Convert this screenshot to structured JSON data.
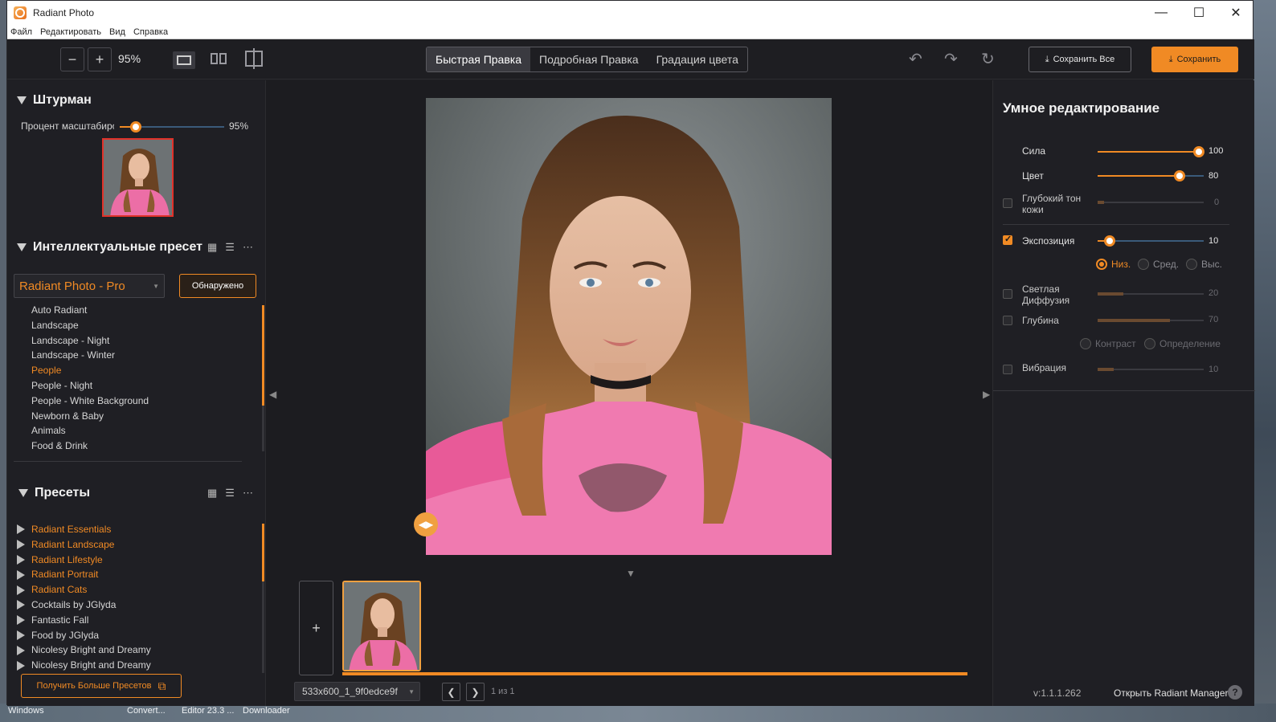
{
  "window": {
    "title": "Radiant Photo",
    "controls": [
      "—",
      "☐",
      "✕"
    ]
  },
  "menu": [
    "Файл",
    "Редактировать",
    "Вид",
    "Справка"
  ],
  "toolbar": {
    "zoom_out": "−",
    "zoom_in": "+",
    "zoom_level": "95%",
    "tabs": [
      "Быстрая Правка",
      "Подробная Правка",
      "Градация цвета"
    ],
    "active_tab": "Быстрая Правка",
    "save_all_label": "Сохранить Все",
    "save_label": "Сохранить"
  },
  "navigator": {
    "title": "Штурман",
    "zoom_label": "Процент масштабиро",
    "zoom_value": "95%",
    "zoom_fraction": 0.15
  },
  "smart_presets": {
    "title": "Интеллектуальные пресеты",
    "dropdown_value": "Radiant Photo - Pro",
    "detected_label": "Обнаружено",
    "items": [
      "Auto Radiant",
      "Landscape",
      "Landscape - Night",
      "Landscape - Winter",
      "People",
      "People - Night",
      "People - White Background",
      "Newborn & Baby",
      "Animals",
      "Food & Drink"
    ],
    "highlighted": "People"
  },
  "presets": {
    "title": "Пресеты",
    "items": [
      {
        "label": "Radiant Essentials",
        "accent": true
      },
      {
        "label": "Radiant Landscape",
        "accent": true
      },
      {
        "label": "Radiant Lifestyle",
        "accent": true
      },
      {
        "label": "Radiant Portrait",
        "accent": true
      },
      {
        "label": "Radiant Cats",
        "accent": true
      },
      {
        "label": "Cocktails by JGlyda",
        "accent": false
      },
      {
        "label": "Fantastic Fall",
        "accent": false
      },
      {
        "label": "Food by JGlyda",
        "accent": false
      },
      {
        "label": "Nicolesy Bright and Dreamy",
        "accent": false
      },
      {
        "label": "Nicolesy Bright and Dreamy",
        "accent": false
      }
    ],
    "more_label": "Получить Больше Пресетов"
  },
  "filmstrip": {
    "add_label": "+",
    "filename": "533x600_1_9f0edce9f",
    "page_info": "1 из 1"
  },
  "smart_edit": {
    "title": "Умное редактирование",
    "sliders": [
      {
        "label": "Сила",
        "value": "100",
        "level": 0.95,
        "enabled": true,
        "checkbox": false
      },
      {
        "label": "Цвет",
        "value": "80",
        "level": 0.77,
        "enabled": true,
        "checkbox": false
      },
      {
        "label": "Глубокий тон кожи",
        "value": "0",
        "level": 0.0,
        "enabled": false,
        "checkbox": true,
        "checked": false
      },
      {
        "label": "Экспозиция",
        "value": "10",
        "level": 0.11,
        "enabled": true,
        "checkbox": true,
        "checked": true
      },
      {
        "label": "Светлая Диффузия",
        "value": "20",
        "level": 0.2,
        "enabled": false,
        "checkbox": true,
        "checked": false
      },
      {
        "label": "Глубина",
        "value": "70",
        "level": 0.7,
        "enabled": false,
        "checkbox": true,
        "checked": false
      },
      {
        "label": "Вибрация",
        "value": "10",
        "level": 0.1,
        "enabled": false,
        "checkbox": true,
        "checked": false
      }
    ],
    "exposure_modes": [
      "Низ.",
      "Сред.",
      "Выс."
    ],
    "exposure_selected": "Низ.",
    "depth_modes": [
      "Контраст",
      "Определение"
    ],
    "version": "v:1.1.1.262",
    "manager_link": "Открыть Radiant Manager",
    "help": "?"
  },
  "taskbar": [
    "Windows",
    "Convert...",
    "Editor 23.3 ...",
    "Downloader"
  ],
  "colors": {
    "accent": "#f08a24",
    "panel": "#1f1f24",
    "canvas": "#1c1c20"
  }
}
